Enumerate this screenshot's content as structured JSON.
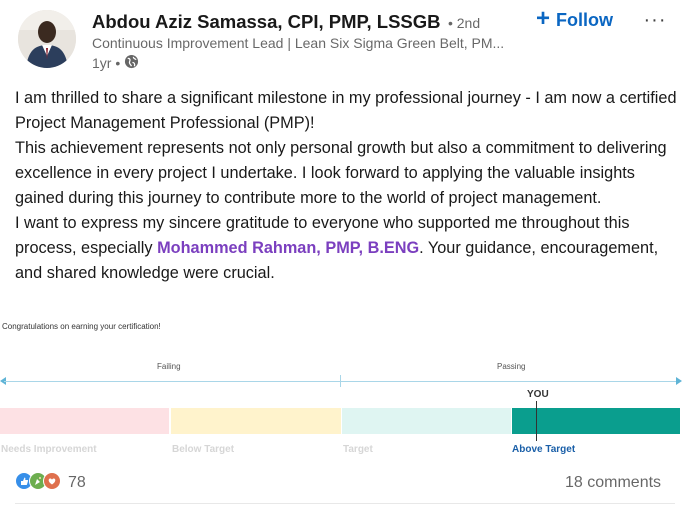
{
  "author": {
    "name": "Abdou Aziz Samassa, CPI, PMP, LSSGB",
    "degree": "• 2nd",
    "headline": "Continuous Improvement Lead | Lean Six Sigma Green Belt, PM...",
    "time": "1yr •"
  },
  "actions": {
    "follow_label": "Follow",
    "more_label": "···"
  },
  "post": {
    "p1": "I am thrilled to share a significant milestone in my professional journey - I am now a certified Project Management Professional (PMP)!",
    "p2": "This achievement represents not only personal growth but also a commitment to delivering excellence in every project I undertake. I look forward to applying the valuable insights gained during this journey to contribute more to the world of project management.",
    "p3_before": "I want to express my sincere gratitude to everyone who supported me throughout this process, especially ",
    "mention": "Mohammed Rahman, PMP, B.ENG",
    "p3_after": ". Your guidance, encouragement, and shared knowledge were crucial."
  },
  "certificate": {
    "title": "Congratulations on earning your certification!",
    "failing": "Failing",
    "passing": "Passing",
    "you": "YOU",
    "segments": [
      "Needs Improvement",
      "Below Target",
      "Target",
      "Above Target"
    ],
    "result": "Above Target"
  },
  "social": {
    "reaction_count": "78",
    "comments": "18 comments"
  },
  "colors": {
    "accent": "#0a66c2",
    "mention": "#7b3fbf",
    "pass_segment": "#0a9e8e"
  }
}
